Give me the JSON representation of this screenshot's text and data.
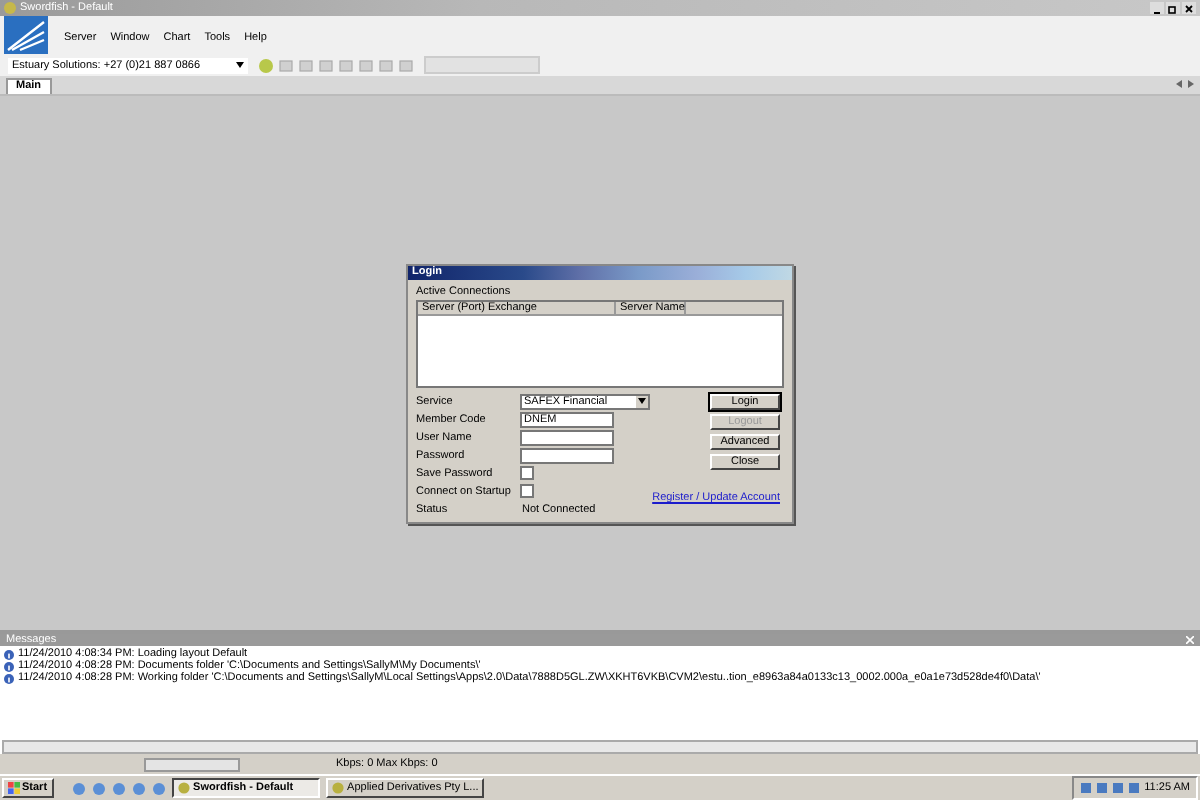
{
  "window": {
    "title": "Swordfish - Default"
  },
  "menu": [
    "Server",
    "Window",
    "Chart",
    "Tools",
    "Help"
  ],
  "toolbar": {
    "contact": "Estuary Solutions: +27 (0)21 887 0866"
  },
  "tabs": [
    {
      "label": "Main",
      "selected": true
    }
  ],
  "login": {
    "title": "Login",
    "connections_label": "Active Connections",
    "columns": [
      "Server (Port) Exchange",
      "Server Name"
    ],
    "fields": [
      {
        "kind": "select",
        "label": "Service",
        "value": "SAFEX Financial"
      },
      {
        "kind": "text",
        "label": "Member Code",
        "value": "DNEM"
      },
      {
        "kind": "text",
        "label": "User Name"
      },
      {
        "kind": "text",
        "label": "Password"
      },
      {
        "kind": "checkbox",
        "label": "Save Password",
        "checked": false
      },
      {
        "kind": "checkbox",
        "label": "Connect on Startup",
        "checked": false
      },
      {
        "kind": "status",
        "label": "Status",
        "value": "Not Connected"
      }
    ],
    "buttons": [
      {
        "label": "Login",
        "disabled": false
      },
      {
        "label": "Logout",
        "disabled": true
      },
      {
        "label": "Advanced",
        "disabled": false
      },
      {
        "label": "Close",
        "disabled": false
      }
    ],
    "link": "Register / Update Account"
  },
  "messages": {
    "title": "Messages",
    "lines": [
      "11/24/2010 4:08:34 PM: Loading layout Default",
      "11/24/2010 4:08:28 PM: Documents folder 'C:\\Documents and Settings\\SallyM\\My Documents\\'",
      "11/24/2010 4:08:28 PM: Working folder 'C:\\Documents and Settings\\SallyM\\Local Settings\\Apps\\2.0\\Data\\7888D5GL.ZW\\XKHT6VKB\\CVM2\\estu..tion_e8963a84a0133c13_0002.000a_e0a1e73d528de4f0\\Data\\'"
    ]
  },
  "status_bar": {
    "text": "Kbps: 0 Max Kbps: 0"
  },
  "taskbar": {
    "start": "Start",
    "tasks": [
      {
        "label": "Swordfish - Default",
        "selected": true
      },
      {
        "label": "Applied Derivatives Pty L...",
        "selected": false
      }
    ],
    "clock": "11:25 AM"
  }
}
